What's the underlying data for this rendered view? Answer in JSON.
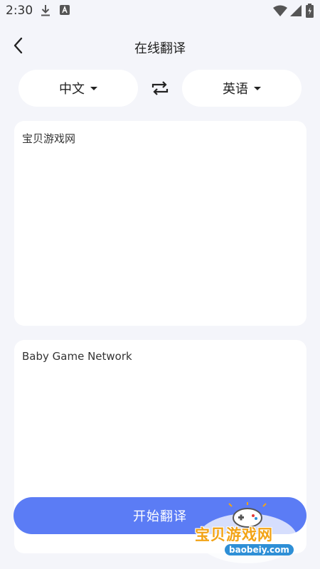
{
  "status_bar": {
    "time": "2:30",
    "icons": [
      "download-icon",
      "app-notification-icon",
      "wifi-icon",
      "cell-signal-icon",
      "battery-icon"
    ]
  },
  "header": {
    "title": "在线翻译",
    "back_icon": "back-arrow-icon"
  },
  "language_selector": {
    "source_language": "中文",
    "target_language": "英语",
    "swap_icon": "swap-arrows-icon"
  },
  "source_text": "宝贝游戏网",
  "result_text": "Baby Game Network",
  "translate_button_label": "开始翻译",
  "watermark": {
    "brand": "宝贝游戏网",
    "domain": "baobeiy.com"
  },
  "colors": {
    "background": "#f4f5fa",
    "accent": "#5b7cf5",
    "card": "#ffffff",
    "watermark_orange": "#f2a316",
    "watermark_blue": "#2e8fd6"
  }
}
